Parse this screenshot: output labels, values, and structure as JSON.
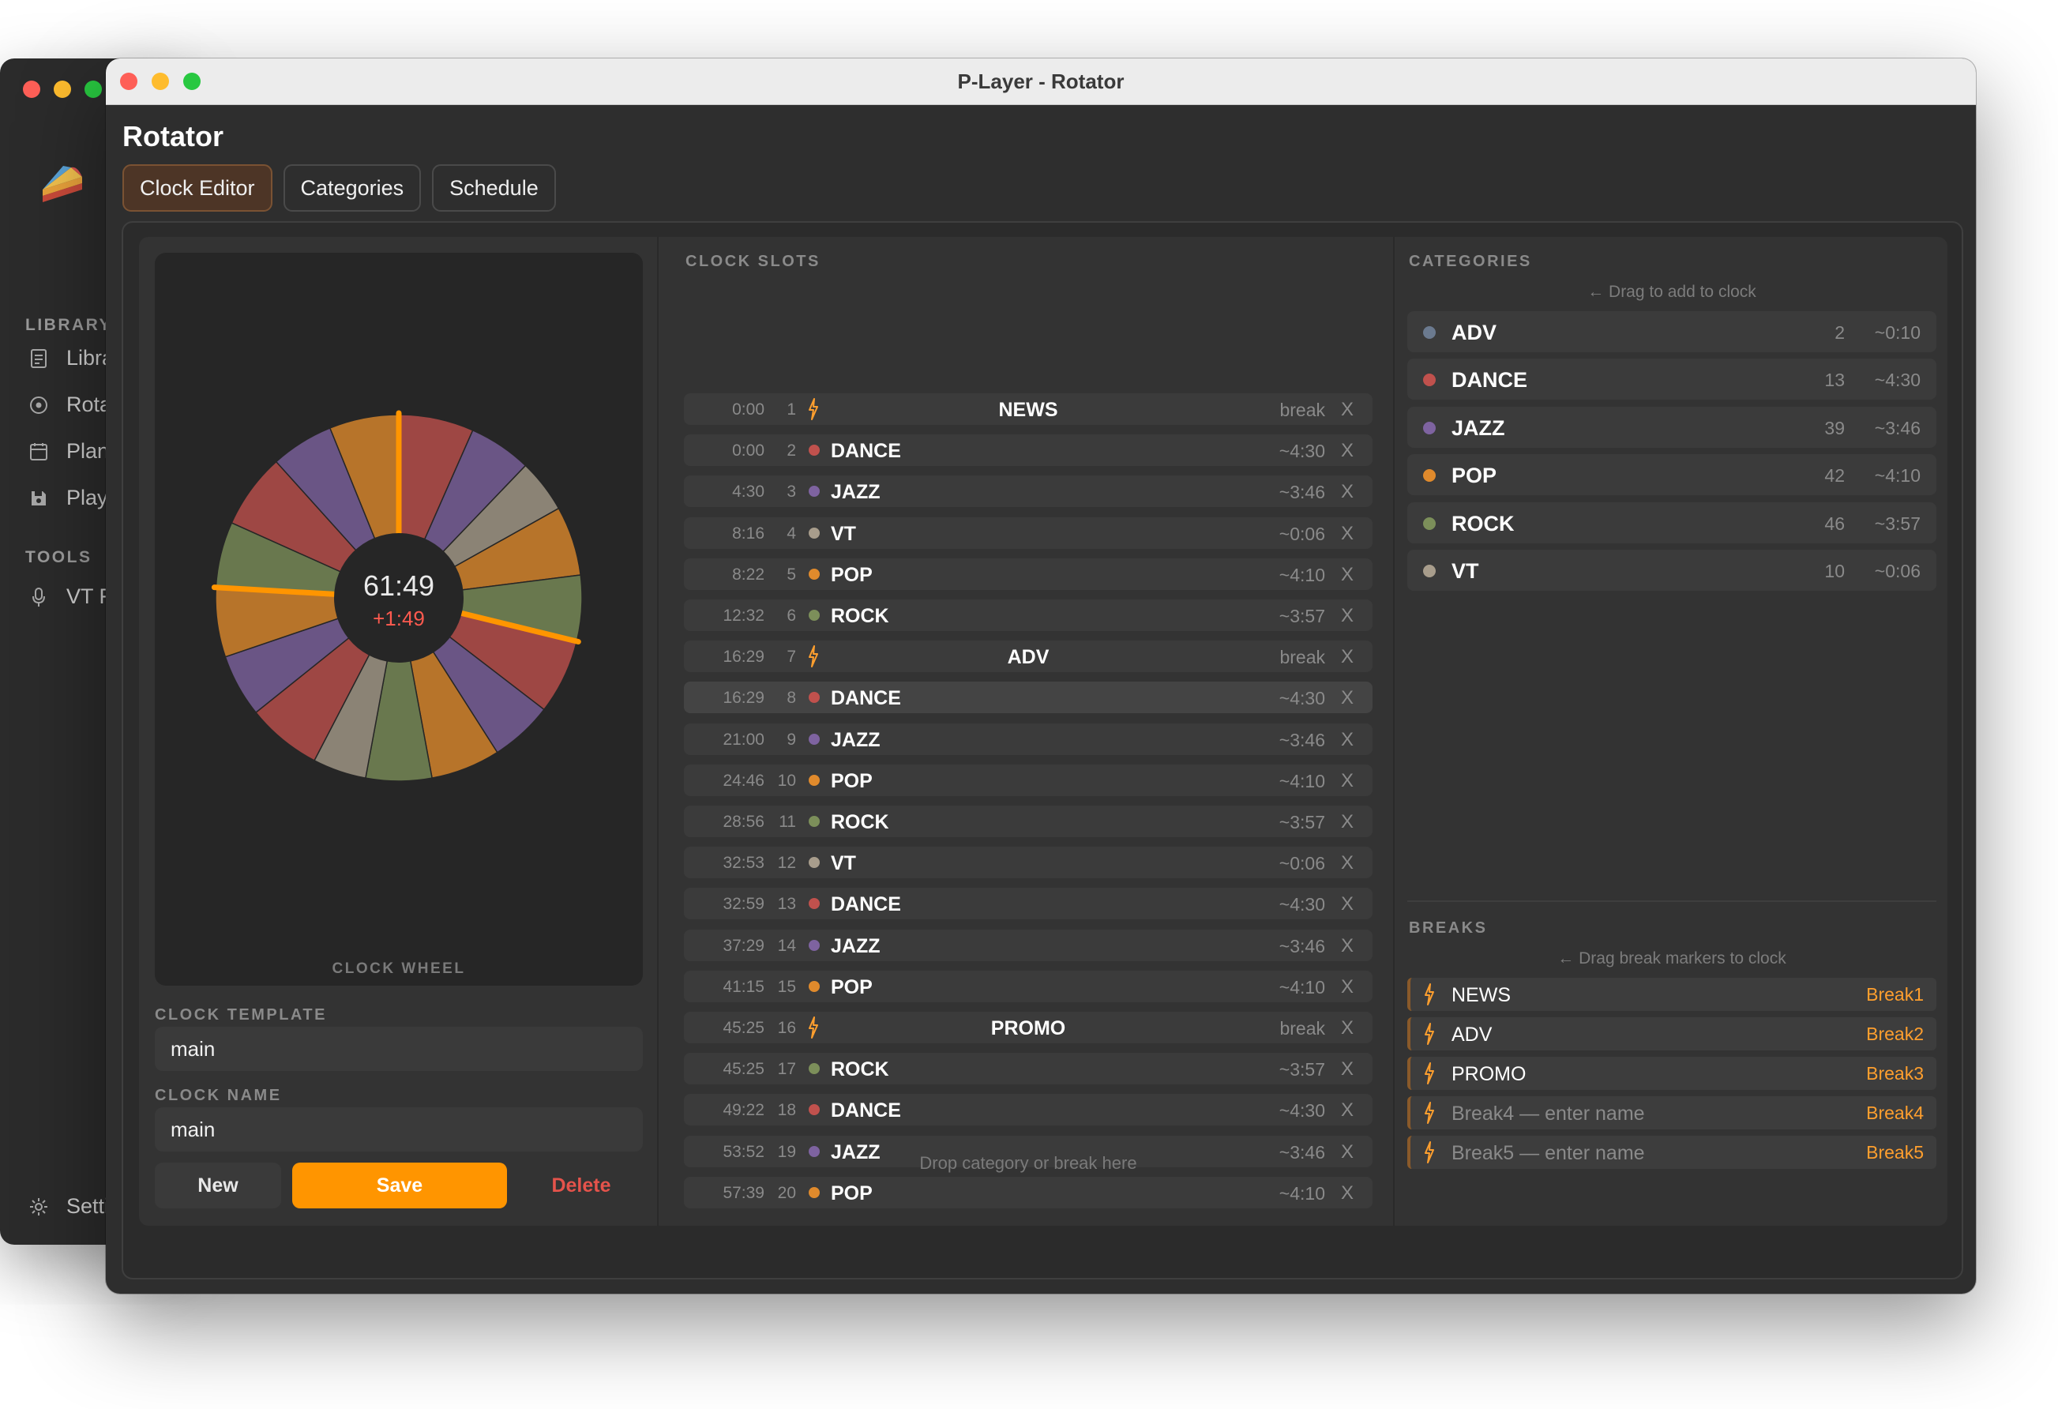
{
  "window": {
    "title": "P-Layer - Rotator"
  },
  "sidebar": {
    "library_section": "LIBRARY",
    "tools_section": "TOOLS",
    "items": [
      {
        "label": "Libra",
        "icon": "document-icon"
      },
      {
        "label": "Rota",
        "icon": "target-icon"
      },
      {
        "label": "Plan",
        "icon": "calendar-icon"
      },
      {
        "label": "Play",
        "icon": "save-icon"
      }
    ],
    "tools": [
      {
        "label": "VT F",
        "icon": "microphone-icon"
      }
    ],
    "settings_label": "Setti"
  },
  "page": {
    "title": "Rotator"
  },
  "tabs": [
    {
      "label": "Clock Editor",
      "active": true
    },
    {
      "label": "Categories",
      "active": false
    },
    {
      "label": "Schedule",
      "active": false
    }
  ],
  "wheel": {
    "section_label": "CLOCK WHEEL",
    "total": "61:49",
    "over": "+1:49"
  },
  "template": {
    "label": "CLOCK TEMPLATE",
    "value": "main"
  },
  "clock_name": {
    "label": "CLOCK NAME",
    "value": "main"
  },
  "buttons": {
    "new": "New",
    "save": "Save",
    "delete": "Delete"
  },
  "slots": {
    "section_label": "CLOCK SLOTS",
    "drop_hint": "Drop category or break here",
    "items": [
      {
        "time": "0:00",
        "idx": "1",
        "name": "NEWS",
        "type": "break",
        "dur": "break",
        "remove": "X"
      },
      {
        "time": "0:00",
        "idx": "2",
        "name": "DANCE",
        "type": "cat",
        "color": "#c0514d",
        "dur": "~4:30",
        "remove": "X"
      },
      {
        "time": "4:30",
        "idx": "3",
        "name": "JAZZ",
        "type": "cat",
        "color": "#7e63a0",
        "dur": "~3:46",
        "remove": "X"
      },
      {
        "time": "8:16",
        "idx": "4",
        "name": "VT",
        "type": "cat",
        "color": "#a89d8c",
        "dur": "~0:06",
        "remove": "X"
      },
      {
        "time": "8:22",
        "idx": "5",
        "name": "POP",
        "type": "cat",
        "color": "#e08a2c",
        "dur": "~4:10",
        "remove": "X"
      },
      {
        "time": "12:32",
        "idx": "6",
        "name": "ROCK",
        "type": "cat",
        "color": "#7c8f5a",
        "dur": "~3:57",
        "remove": "X"
      },
      {
        "time": "16:29",
        "idx": "7",
        "name": "ADV",
        "type": "break",
        "dur": "break",
        "remove": "X"
      },
      {
        "time": "16:29",
        "idx": "8",
        "name": "DANCE",
        "type": "cat",
        "color": "#c0514d",
        "dur": "~4:30",
        "remove": "X",
        "highlight": true
      },
      {
        "time": "21:00",
        "idx": "9",
        "name": "JAZZ",
        "type": "cat",
        "color": "#7e63a0",
        "dur": "~3:46",
        "remove": "X"
      },
      {
        "time": "24:46",
        "idx": "10",
        "name": "POP",
        "type": "cat",
        "color": "#e08a2c",
        "dur": "~4:10",
        "remove": "X"
      },
      {
        "time": "28:56",
        "idx": "11",
        "name": "ROCK",
        "type": "cat",
        "color": "#7c8f5a",
        "dur": "~3:57",
        "remove": "X"
      },
      {
        "time": "32:53",
        "idx": "12",
        "name": "VT",
        "type": "cat",
        "color": "#a89d8c",
        "dur": "~0:06",
        "remove": "X"
      },
      {
        "time": "32:59",
        "idx": "13",
        "name": "DANCE",
        "type": "cat",
        "color": "#c0514d",
        "dur": "~4:30",
        "remove": "X"
      },
      {
        "time": "37:29",
        "idx": "14",
        "name": "JAZZ",
        "type": "cat",
        "color": "#7e63a0",
        "dur": "~3:46",
        "remove": "X"
      },
      {
        "time": "41:15",
        "idx": "15",
        "name": "POP",
        "type": "cat",
        "color": "#e08a2c",
        "dur": "~4:10",
        "remove": "X"
      },
      {
        "time": "45:25",
        "idx": "16",
        "name": "PROMO",
        "type": "break",
        "dur": "break",
        "remove": "X"
      },
      {
        "time": "45:25",
        "idx": "17",
        "name": "ROCK",
        "type": "cat",
        "color": "#7c8f5a",
        "dur": "~3:57",
        "remove": "X"
      },
      {
        "time": "49:22",
        "idx": "18",
        "name": "DANCE",
        "type": "cat",
        "color": "#c0514d",
        "dur": "~4:30",
        "remove": "X"
      },
      {
        "time": "53:52",
        "idx": "19",
        "name": "JAZZ",
        "type": "cat",
        "color": "#7e63a0",
        "dur": "~3:46",
        "remove": "X"
      },
      {
        "time": "57:39",
        "idx": "20",
        "name": "POP",
        "type": "cat",
        "color": "#e08a2c",
        "dur": "~4:10",
        "remove": "X"
      }
    ]
  },
  "categories": {
    "section_label": "CATEGORIES",
    "hint": "← Drag to add to clock",
    "items": [
      {
        "name": "ADV",
        "color": "#6b7a8f",
        "count": "2",
        "dur": "~0:10"
      },
      {
        "name": "DANCE",
        "color": "#c0514d",
        "count": "13",
        "dur": "~4:30"
      },
      {
        "name": "JAZZ",
        "color": "#7e63a0",
        "count": "39",
        "dur": "~3:46"
      },
      {
        "name": "POP",
        "color": "#e08a2c",
        "count": "42",
        "dur": "~4:10"
      },
      {
        "name": "ROCK",
        "color": "#7c8f5a",
        "count": "46",
        "dur": "~3:57"
      },
      {
        "name": "VT",
        "color": "#a89d8c",
        "count": "10",
        "dur": "~0:06"
      }
    ]
  },
  "breaks": {
    "section_label": "BREAKS",
    "hint": "← Drag break markers to clock",
    "items": [
      {
        "name": "NEWS",
        "tag": "Break1",
        "placeholder": false
      },
      {
        "name": "ADV",
        "tag": "Break2",
        "placeholder": false
      },
      {
        "name": "PROMO",
        "tag": "Break3",
        "placeholder": false
      },
      {
        "name": "Break4 — enter name",
        "tag": "Break4",
        "placeholder": true
      },
      {
        "name": "Break5 — enter name",
        "tag": "Break5",
        "placeholder": true
      }
    ]
  },
  "colors": {
    "accent": "#ff9500",
    "danger": "#e5534b",
    "over_time": "#ff5a4f"
  }
}
